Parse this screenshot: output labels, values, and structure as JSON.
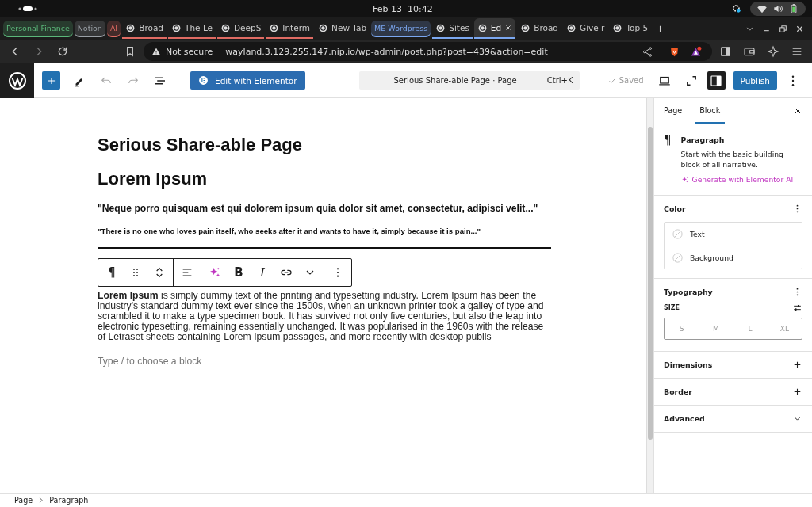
{
  "system_bar": {
    "date": "Feb 13",
    "time": "10:42"
  },
  "tab_strip": {
    "items": [
      {
        "kind": "group",
        "label": "Personal Finance",
        "color": "#5bb77a"
      },
      {
        "kind": "group",
        "label": "Notion",
        "color": "#9aa0a6"
      },
      {
        "kind": "group",
        "label": "AI",
        "color": "#e06b63",
        "tabs": [
          {
            "label": "Broad",
            "selected": false
          },
          {
            "label": "The Le",
            "selected": false
          },
          {
            "label": "DeepS",
            "selected": false
          },
          {
            "label": "Interm",
            "selected": false
          }
        ]
      },
      {
        "kind": "tab",
        "label": "New Tab",
        "selected": false
      },
      {
        "kind": "group",
        "label": "ME-Wordpress",
        "color": "#7ba7f0",
        "tabs": [
          {
            "label": "Sites",
            "selected": false
          },
          {
            "label": "Ed",
            "selected": true
          }
        ]
      },
      {
        "kind": "tab",
        "label": "Broad",
        "selected": false
      },
      {
        "kind": "tab",
        "label": "Give r",
        "selected": false
      },
      {
        "kind": "tab",
        "label": "Top 5",
        "selected": false
      }
    ]
  },
  "address_bar": {
    "security": "Not secure",
    "url": "wayland.3.129.255.147.nip.io/wp-admin/post.php?post=439&action=edit"
  },
  "editor_toolbar": {
    "elementor": "Edit with Elementor",
    "command": {
      "title": "Serious Share-able Page · Page",
      "shortcut": "Ctrl+K"
    },
    "status": "Saved",
    "sidebar_open": true,
    "publish": "Publish"
  },
  "canvas": {
    "title": "Serious Share-able Page",
    "blocks": [
      {
        "kind": "heading",
        "text": "Lorem Ipsum"
      },
      {
        "kind": "quote",
        "text": "\"Neque porro quisquam est qui dolorem ipsum quia dolor sit amet, consectetur, adipisci velit...\""
      },
      {
        "kind": "small",
        "text": "\"There is no one who loves pain itself, who seeks after it and wants to have it, simply because it is pain...\""
      },
      {
        "kind": "separator"
      },
      {
        "kind": "paragraph",
        "selected": true,
        "text": "**Lorem Ipsum** is simply dummy text of the printing and typesetting industry. Lorem Ipsum has been the industry's standard dummy text ever since the 1500s, when an unknown printer took a galley of type and scrambled it to make a type specimen book. It has survived not only five centuries, but also the leap into electronic typesetting, remaining essentially unchanged. It was popularised in the 1960s with the release of Letraset sheets containing Lorem Ipsum passages, and more recently with desktop publis"
      }
    ],
    "block_toolbar": {
      "block_icon": "¶",
      "bold": "B",
      "italic": "I"
    },
    "appender": "Type / to choose a block"
  },
  "sidebar": {
    "tabs": [
      {
        "label": "Page",
        "selected": false
      },
      {
        "label": "Block",
        "selected": true
      }
    ],
    "block": {
      "icon": "¶",
      "name": "Paragraph",
      "description": "Start with the basic building block of all narrative.",
      "ai_link": "Generate with Elementor AI"
    },
    "panels": [
      {
        "kind": "color",
        "title": "Color",
        "options": [
          "Text",
          "Background"
        ]
      },
      {
        "kind": "typography",
        "title": "Typography",
        "size_label": "SIZE",
        "sizes": [
          {
            "label": "S",
            "selected": false
          },
          {
            "label": "M",
            "selected": false
          },
          {
            "label": "L",
            "selected": false
          },
          {
            "label": "XL",
            "selected": false
          }
        ]
      },
      {
        "kind": "addable",
        "title": "Dimensions"
      },
      {
        "kind": "addable",
        "title": "Border"
      },
      {
        "kind": "collapsible",
        "title": "Advanced"
      }
    ]
  },
  "breadcrumb": [
    "Page",
    "Paragraph"
  ]
}
